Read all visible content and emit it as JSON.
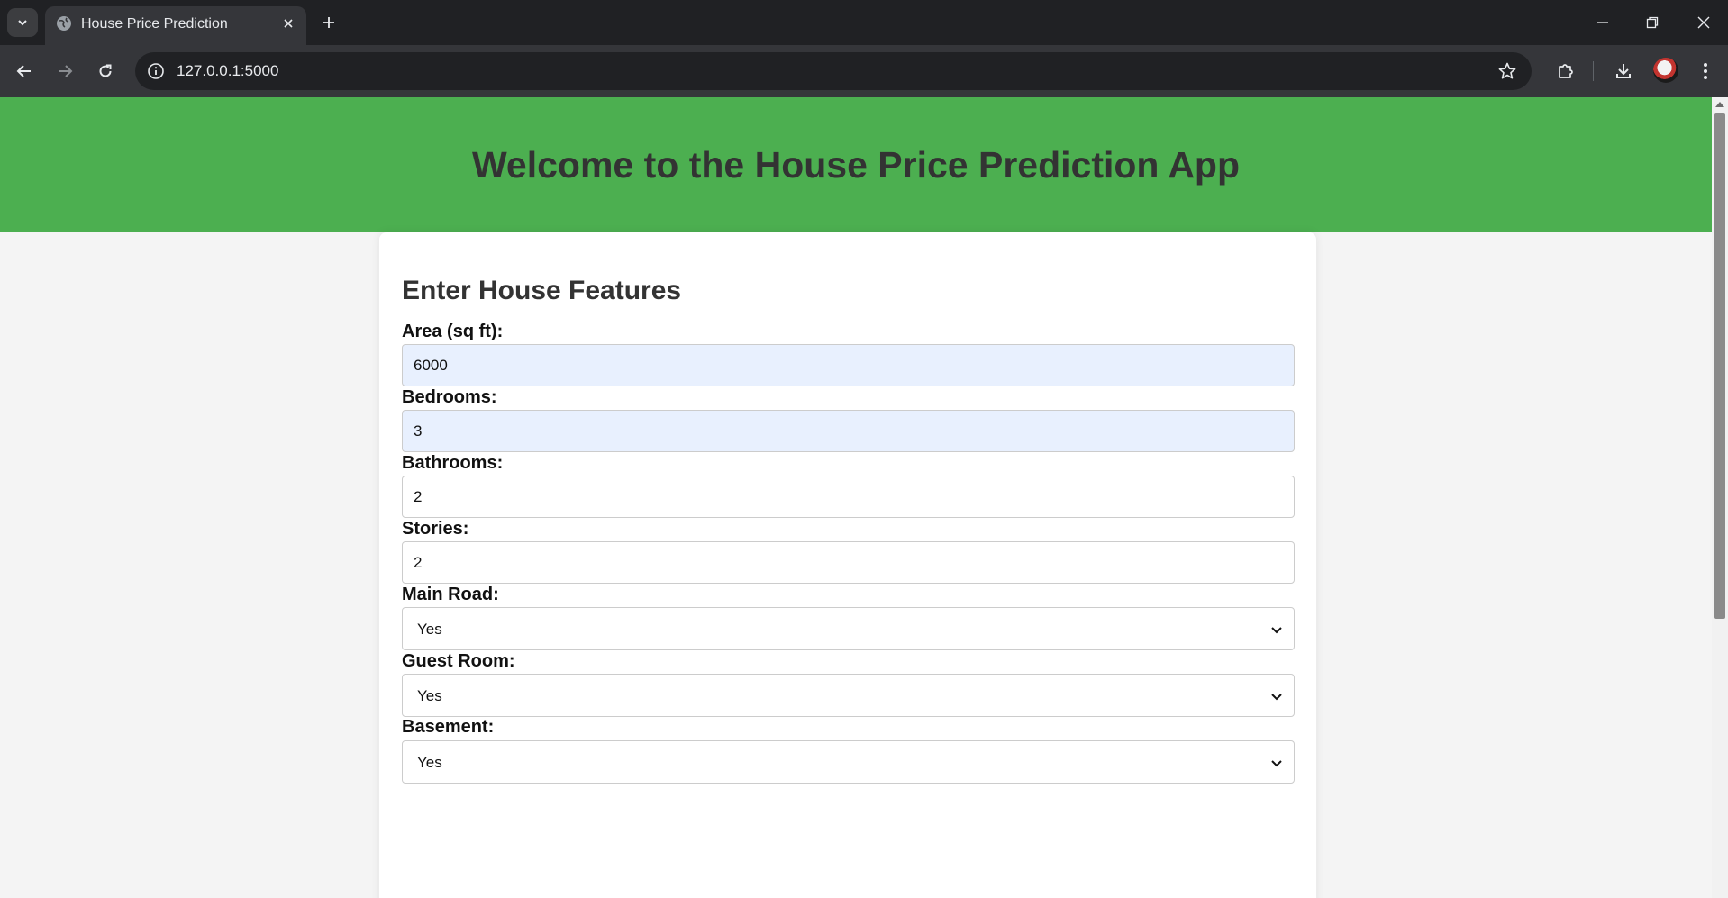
{
  "browser": {
    "tab_title": "House Price Prediction",
    "url": "127.0.0.1:5000"
  },
  "colors": {
    "header_bg": "#4caf50",
    "autofill_bg": "#e8f0fe"
  },
  "page": {
    "heading": "Welcome to the House Price Prediction App",
    "form_title": "Enter House Features",
    "fields": [
      {
        "label": "Area (sq ft):",
        "value": "6000"
      },
      {
        "label": "Bedrooms:",
        "value": "3"
      },
      {
        "label": "Bathrooms:",
        "value": "2"
      },
      {
        "label": "Stories:",
        "value": "2"
      },
      {
        "label": "Main Road:",
        "selected": "Yes"
      },
      {
        "label": "Guest Room:",
        "selected": "Yes"
      },
      {
        "label": "Basement:",
        "selected": "Yes"
      }
    ]
  }
}
